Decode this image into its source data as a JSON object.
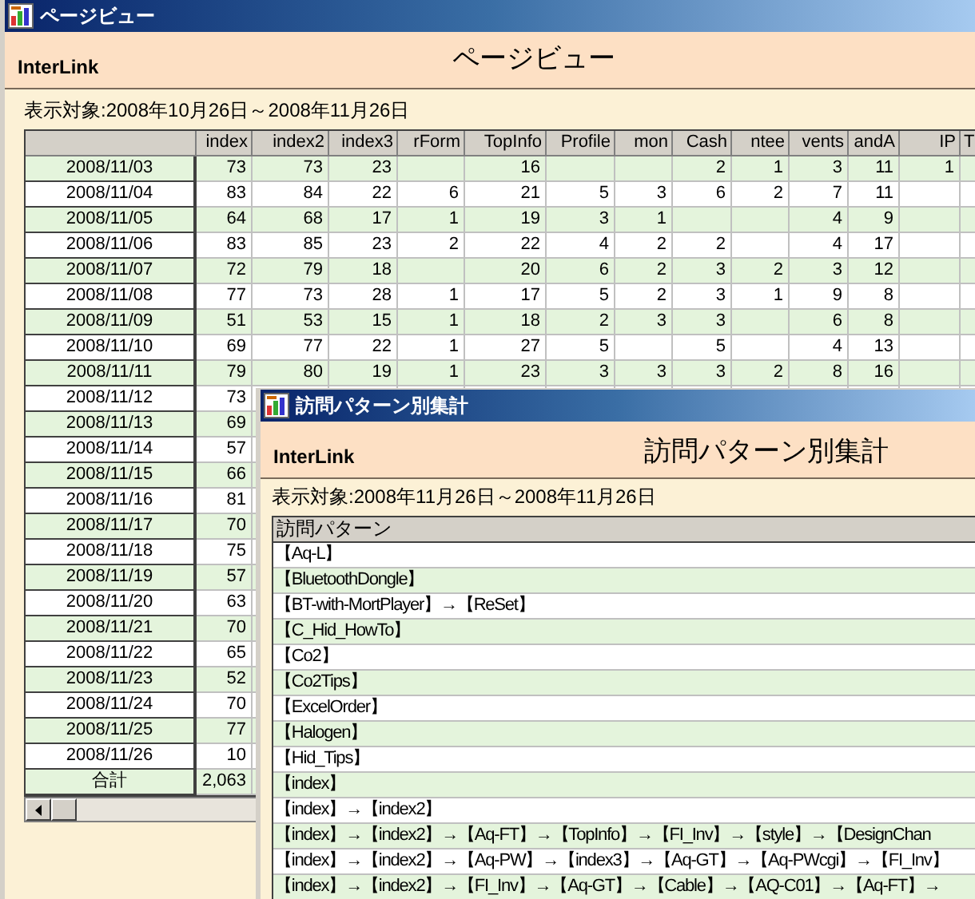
{
  "windows": [
    {
      "title": "ページビュー",
      "brand": "InterLink",
      "heading": "ページビュー",
      "range": "表示対象:2008年10月26日～2008年11月26日",
      "table": {
        "columns": [
          "index",
          "index2",
          "index3",
          "rForm",
          "TopInfo",
          "Profile",
          "mon",
          "Cash",
          "ntee",
          "vents",
          "andA",
          "IP",
          "T"
        ],
        "rows": [
          {
            "date": "2008/11/03",
            "cells": [
              "73",
              "73",
              "23",
              null,
              "16",
              null,
              null,
              "2",
              "1",
              "3",
              "11",
              "1",
              null
            ]
          },
          {
            "date": "2008/11/04",
            "cells": [
              "83",
              "84",
              "22",
              "6",
              "21",
              "5",
              "3",
              "6",
              "2",
              "7",
              "11",
              null,
              null
            ]
          },
          {
            "date": "2008/11/05",
            "cells": [
              "64",
              "68",
              "17",
              "1",
              "19",
              "3",
              "1",
              null,
              null,
              "4",
              "9",
              null,
              null
            ]
          },
          {
            "date": "2008/11/06",
            "cells": [
              "83",
              "85",
              "23",
              "2",
              "22",
              "4",
              "2",
              "2",
              null,
              "4",
              "17",
              null,
              null
            ]
          },
          {
            "date": "2008/11/07",
            "cells": [
              "72",
              "79",
              "18",
              null,
              "20",
              "6",
              "2",
              "3",
              "2",
              "3",
              "12",
              null,
              null
            ]
          },
          {
            "date": "2008/11/08",
            "cells": [
              "77",
              "73",
              "28",
              "1",
              "17",
              "5",
              "2",
              "3",
              "1",
              "9",
              "8",
              null,
              null
            ]
          },
          {
            "date": "2008/11/09",
            "cells": [
              "51",
              "53",
              "15",
              "1",
              "18",
              "2",
              "3",
              "3",
              null,
              "6",
              "8",
              null,
              null
            ]
          },
          {
            "date": "2008/11/10",
            "cells": [
              "69",
              "77",
              "22",
              "1",
              "27",
              "5",
              null,
              "5",
              null,
              "4",
              "13",
              null,
              null
            ]
          },
          {
            "date": "2008/11/11",
            "cells": [
              "79",
              "80",
              "19",
              "1",
              "23",
              "3",
              "3",
              "3",
              "2",
              "8",
              "16",
              null,
              null
            ]
          },
          {
            "date": "2008/11/12",
            "cells": [
              "73"
            ]
          },
          {
            "date": "2008/11/13",
            "cells": [
              "69"
            ]
          },
          {
            "date": "2008/11/14",
            "cells": [
              "57"
            ]
          },
          {
            "date": "2008/11/15",
            "cells": [
              "66"
            ]
          },
          {
            "date": "2008/11/16",
            "cells": [
              "81"
            ]
          },
          {
            "date": "2008/11/17",
            "cells": [
              "70"
            ]
          },
          {
            "date": "2008/11/18",
            "cells": [
              "75"
            ]
          },
          {
            "date": "2008/11/19",
            "cells": [
              "57"
            ]
          },
          {
            "date": "2008/11/20",
            "cells": [
              "63"
            ]
          },
          {
            "date": "2008/11/21",
            "cells": [
              "70"
            ]
          },
          {
            "date": "2008/11/22",
            "cells": [
              "65"
            ]
          },
          {
            "date": "2008/11/23",
            "cells": [
              "52"
            ]
          },
          {
            "date": "2008/11/24",
            "cells": [
              "70"
            ]
          },
          {
            "date": "2008/11/25",
            "cells": [
              "77"
            ]
          },
          {
            "date": "2008/11/26",
            "cells": [
              "10"
            ]
          }
        ],
        "total": {
          "label": "合計",
          "cells": [
            "2,063"
          ]
        }
      }
    },
    {
      "title": "訪問パターン別集計",
      "brand": "InterLink",
      "heading": "訪問パターン別集計",
      "range": "表示対象:2008年11月26日～2008年11月26日",
      "table": {
        "columns": [
          "訪問パターン"
        ],
        "rows": [
          "【Aq-L】",
          "【BluetoothDongle】",
          "【BT-with-MortPlayer】→【ReSet】",
          "【C_Hid_HowTo】",
          "【Co2】",
          "【Co2Tips】",
          "【ExcelOrder】",
          "【Halogen】",
          "【Hid_Tips】",
          "【index】",
          "【index】→【index2】",
          "【index】→【index2】→【Aq-FT】→【TopInfo】→【FI_Inv】→【style】→【DesignChan",
          "【index】→【index2】→【Aq-PW】→【index3】→【Aq-GT】→【Aq-PWcgi】→【FI_Inv】",
          "【index】→【index2】→【FI_Inv】→【Aq-GT】→【Cable】→【AQ-C01】→【Aq-FT】→"
        ]
      }
    }
  ]
}
